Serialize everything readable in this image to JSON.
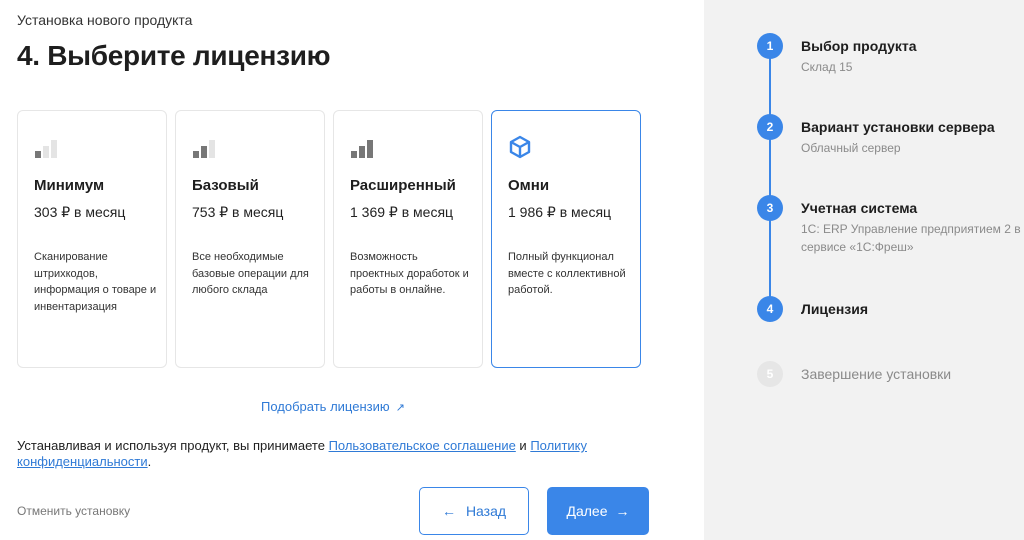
{
  "header": {
    "subtitle": "Установка нового продукта",
    "title": "4. Выберите лицензию"
  },
  "cards": [
    {
      "name": "Минимум",
      "price": "303 ₽ в месяц",
      "desc": "Сканирование штрихкодов, информация о товаре и инвентаризация",
      "icon": "signal-1-bar-icon",
      "level": 1
    },
    {
      "name": "Базовый",
      "price": "753 ₽ в месяц",
      "desc": "Все необходимые базовые операции для любого склада",
      "icon": "signal-2-bars-icon",
      "level": 2
    },
    {
      "name": "Расширенный",
      "price": "1 369 ₽ в месяц",
      "desc": "Возможность проектных доработок и работы в онлайне.",
      "icon": "signal-3-bars-icon",
      "level": 3
    },
    {
      "name": "Омни",
      "price": "1 986 ₽ в месяц",
      "desc": "Полный функционал вместе с коллективной работой.",
      "icon": "cube-icon",
      "selected": true
    }
  ],
  "pick_link": "Подобрать лицензию",
  "agreement": {
    "prefix": "Устанавливая и используя продукт, вы принимаете ",
    "link1": "Пользовательское соглашение",
    "middle": " и ",
    "link2": "Политику конфиденциальности",
    "suffix": "."
  },
  "footer": {
    "cancel": "Отменить установку",
    "back": "Назад",
    "next": "Далее"
  },
  "steps": [
    {
      "num": "1",
      "name": "Выбор продукта",
      "desc": "Склад 15",
      "state": "done"
    },
    {
      "num": "2",
      "name": "Вариант установки сервера",
      "desc": "Облачный сервер",
      "state": "done"
    },
    {
      "num": "3",
      "name": "Учетная система",
      "desc": "1С: ERP Управление предприятием 2 в сервисе «1С:Фреш»",
      "state": "done"
    },
    {
      "num": "4",
      "name": "Лицензия",
      "desc": "",
      "state": "current"
    },
    {
      "num": "5",
      "name": "Завершение установки",
      "desc": "",
      "state": "disabled"
    }
  ],
  "colors": {
    "accent": "#3a86e8",
    "sidebar_bg": "#f2f2f2",
    "bar_active": "#777777",
    "bar_inactive": "#e4e4e4"
  }
}
